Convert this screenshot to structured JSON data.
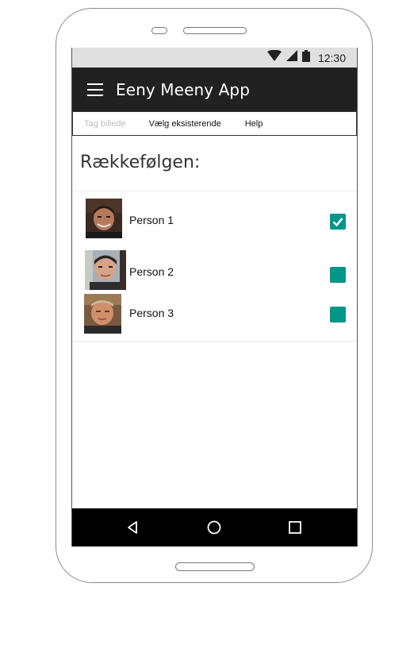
{
  "status_bar": {
    "time": "12:30",
    "icons": [
      "wifi-icon",
      "signal-icon",
      "battery-icon"
    ]
  },
  "app_bar": {
    "menu_icon": "hamburger-menu-icon",
    "title": "Eeny Meeny App"
  },
  "tabs": [
    {
      "label": "Tag billede",
      "enabled": false
    },
    {
      "label": "Vælg eksisterende",
      "enabled": true
    },
    {
      "label": "Help",
      "enabled": true
    }
  ],
  "section_title": "Rækkefølgen:",
  "persons": [
    {
      "name": "Person 1",
      "checked": true,
      "avatar": "person-1-photo"
    },
    {
      "name": "Person 2",
      "checked": false,
      "avatar": "person-2-photo"
    },
    {
      "name": "Person 3",
      "checked": false,
      "avatar": "person-3-photo"
    }
  ],
  "nav_bar": {
    "buttons": [
      "back-icon",
      "home-icon",
      "recents-icon"
    ]
  },
  "colors": {
    "app_bar_bg": "#212121",
    "status_bar_bg": "#e0e0e0",
    "accent": "#009688",
    "nav_bar_bg": "#000000"
  }
}
